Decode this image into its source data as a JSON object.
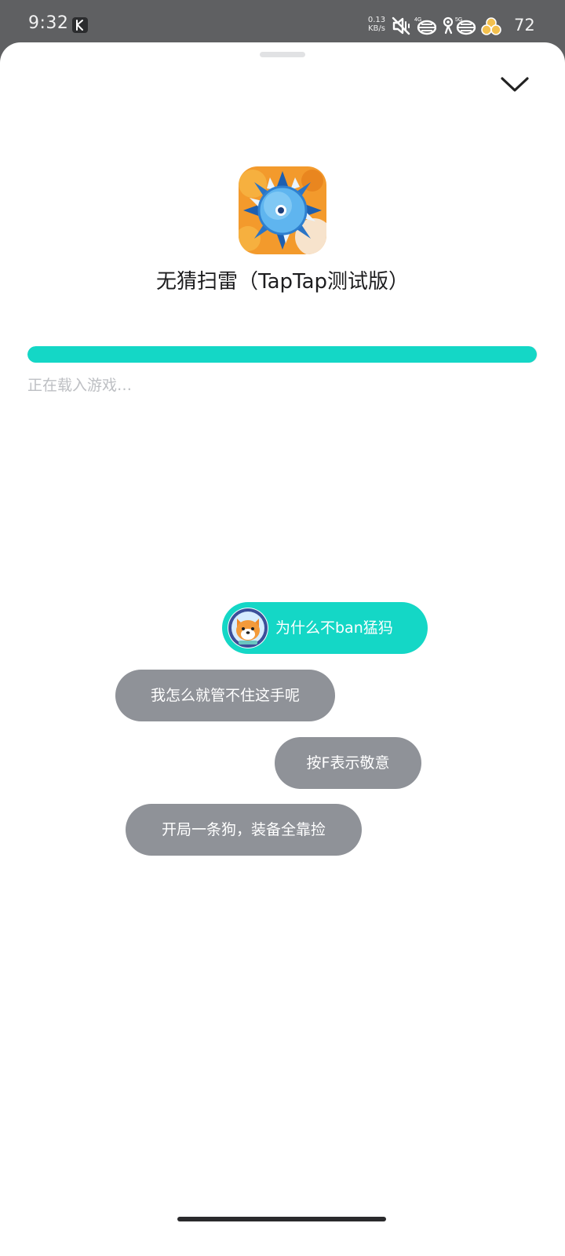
{
  "status_bar": {
    "time": "9:32",
    "net_speed_value": "0.13",
    "net_speed_unit": "KB/s",
    "battery_level": "72",
    "icons": [
      "k-app-icon",
      "mute-vibrate-icon",
      "signal-4g-icon",
      "wifi-icon",
      "signal-5g-icon",
      "battery-icon"
    ]
  },
  "sheet": {
    "collapse_icon": "chevron-down-icon",
    "app": {
      "icon": "minesweeper-game-icon",
      "title": "无猜扫雷（TapTap测试版）"
    },
    "progress": {
      "fraction": 0.999,
      "color": "#14d7c6",
      "status_text": "正在载入游戏…"
    },
    "chips": [
      {
        "text": "为什么不ban猛犸",
        "style": "teal",
        "avatar": "shiba-dog-avatar"
      },
      {
        "text": "我怎么就管不住这手呢",
        "style": "grey"
      },
      {
        "text": "按F表示敬意",
        "style": "grey"
      },
      {
        "text": "开局一条狗，装备全靠捡",
        "style": "grey"
      }
    ]
  },
  "colors": {
    "accent": "#14d7c6",
    "chip_grey": "#8f9298",
    "status_bar_bg": "#5f6062"
  }
}
